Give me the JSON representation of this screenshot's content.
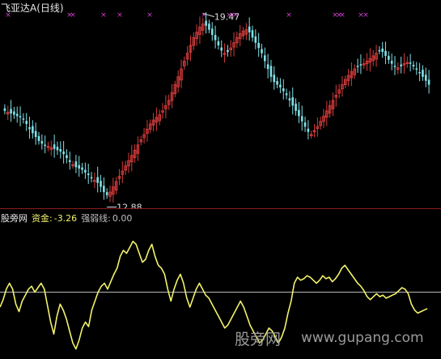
{
  "header": {
    "stock_name": "飞亚达A",
    "period": "(日线)"
  },
  "price_labels": {
    "high": "19.47",
    "low": "12.88"
  },
  "indicator": {
    "name": "股旁网",
    "capital_label": "资金:",
    "capital_value": "-3.26",
    "strength_label": "强弱线:",
    "strength_value": "0.00"
  },
  "watermark": {
    "cn": "股旁网",
    "url": "www.gupang.com"
  },
  "colors": {
    "background": "#000000",
    "up_candle": "#d43b3b",
    "down_candle": "#7fe0e6",
    "signal_x": "#d040d0",
    "gridline": "#8c1d1d",
    "capital_line": "#f2f26a",
    "strength_line": "#b8b8b8",
    "indicator_name": "#e8e8e8",
    "capital_text": "#f2f26a",
    "strength_text": "#bfbfbf"
  },
  "chart_data": [
    {
      "type": "candlestick",
      "title": "飞亚达A (日线)",
      "ylim": [
        12.6,
        19.9
      ],
      "marked_high": 19.47,
      "marked_low": 12.88,
      "signal_marker_count": 16,
      "close_series": [
        16.1,
        16.05,
        16.0,
        15.95,
        15.9,
        15.85,
        15.8,
        15.6,
        15.4,
        15.25,
        15.1,
        14.95,
        14.85,
        14.8,
        14.75,
        14.7,
        14.65,
        14.6,
        14.55,
        14.45,
        14.3,
        14.15,
        14.05,
        13.95,
        13.9,
        13.85,
        13.75,
        13.65,
        13.55,
        13.45,
        13.35,
        13.2,
        13.0,
        12.88,
        13.0,
        13.2,
        13.4,
        13.6,
        13.8,
        14.0,
        14.2,
        14.4,
        14.6,
        14.8,
        15.0,
        15.2,
        15.4,
        15.6,
        15.75,
        15.85,
        15.95,
        16.1,
        16.3,
        16.5,
        16.8,
        17.1,
        17.4,
        17.7,
        18.0,
        18.3,
        18.6,
        18.9,
        19.1,
        19.3,
        19.42,
        19.35,
        19.2,
        19.0,
        18.8,
        18.6,
        18.4,
        18.3,
        18.35,
        18.5,
        18.7,
        18.9,
        19.05,
        19.15,
        19.2,
        19.1,
        18.9,
        18.7,
        18.5,
        18.3,
        18.0,
        17.7,
        17.4,
        17.2,
        17.1,
        17.0,
        16.85,
        16.7,
        16.5,
        16.3,
        16.1,
        15.9,
        15.7,
        15.5,
        15.3,
        15.2,
        15.35,
        15.5,
        15.7,
        15.9,
        16.1,
        16.3,
        16.5,
        16.7,
        16.9,
        17.1,
        17.3,
        17.45,
        17.6,
        17.7,
        17.8,
        17.85,
        17.9,
        18.0,
        18.1,
        18.2,
        18.3,
        18.4,
        18.35,
        18.2,
        18.05,
        17.9,
        17.8,
        17.75,
        17.8,
        17.9,
        17.95,
        17.9,
        17.8,
        17.7,
        17.55,
        17.4,
        17.25,
        17.1
      ]
    },
    {
      "type": "line",
      "series": [
        {
          "name": "资金",
          "values": [
            -1.0,
            -0.5,
            0.2,
            0.6,
            0.2,
            -0.8,
            -1.3,
            -0.6,
            -0.2,
            0.2,
            0.4,
            0.0,
            0.3,
            0.6,
            0.2,
            -0.9,
            -2.0,
            -2.8,
            -1.6,
            -0.8,
            -1.2,
            -1.8,
            -2.6,
            -3.4,
            -3.8,
            -3.2,
            -2.4,
            -2.0,
            -2.3,
            -1.2,
            -0.6,
            0.0,
            0.4,
            0.6,
            0.2,
            0.7,
            1.2,
            1.6,
            2.4,
            2.8,
            2.6,
            3.0,
            3.4,
            3.2,
            2.6,
            2.0,
            2.2,
            2.8,
            3.2,
            2.4,
            1.8,
            1.6,
            1.2,
            0.2,
            -0.6,
            0.2,
            0.8,
            1.2,
            0.6,
            -0.4,
            -1.0,
            -0.4,
            0.2,
            0.6,
            0.2,
            -0.2,
            -0.4,
            -0.8,
            -1.2,
            -1.6,
            -2.0,
            -2.4,
            -2.2,
            -1.8,
            -1.4,
            -1.0,
            -0.6,
            -1.0,
            -1.6,
            -2.2,
            -2.6,
            -3.0,
            -3.4,
            -3.2,
            -2.8,
            -2.4,
            -2.6,
            -3.0,
            -3.4,
            -3.0,
            -2.4,
            -1.4,
            -0.6,
            0.6,
            1.0,
            0.8,
            0.9,
            1.1,
            1.0,
            0.8,
            0.6,
            0.8,
            1.1,
            0.9,
            1.0,
            0.7,
            0.9,
            1.2,
            1.6,
            1.8,
            1.5,
            1.2,
            0.9,
            0.6,
            0.4,
            0.1,
            -0.3,
            -0.5,
            -0.3,
            -0.1,
            -0.3,
            -0.2,
            -0.4,
            -0.3,
            -0.2,
            -0.1,
            0.1,
            0.3,
            0.2,
            -0.1,
            -0.8,
            -1.2,
            -1.4,
            -1.3,
            -1.2,
            -1.1
          ]
        },
        {
          "name": "强弱线",
          "values": [
            0.0,
            0.0
          ]
        }
      ],
      "ylim": [
        -4.2,
        4.8
      ]
    }
  ]
}
